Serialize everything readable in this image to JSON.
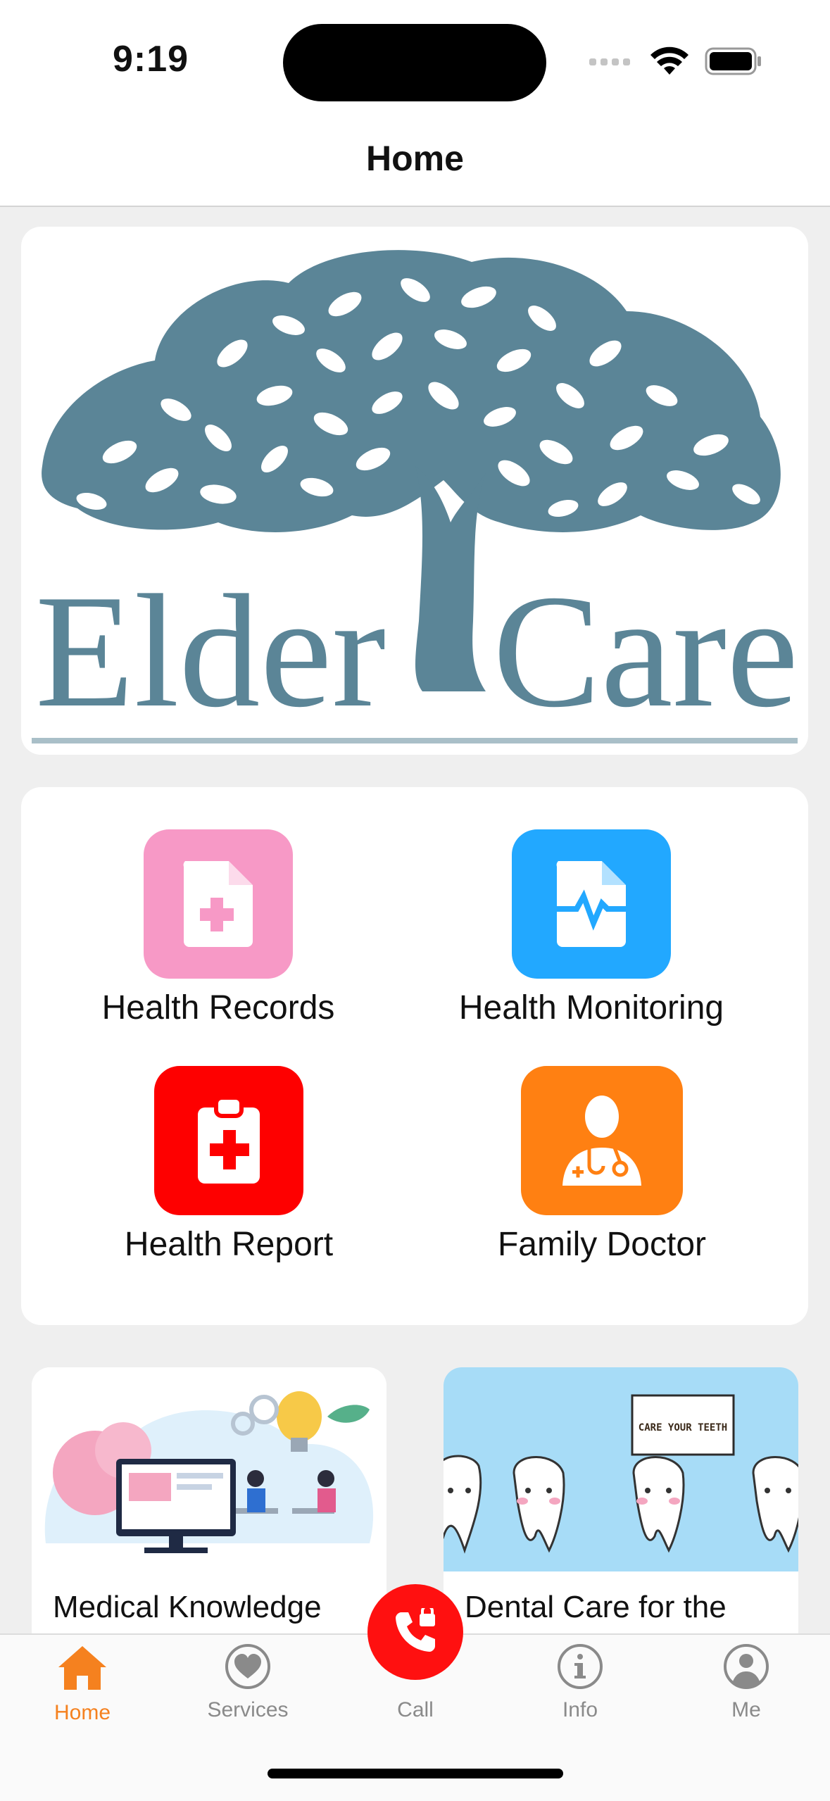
{
  "status_bar": {
    "time": "9:19"
  },
  "nav": {
    "title": "Home"
  },
  "logo": {
    "text_left": "Elder",
    "text_right": "Care",
    "color": "#5b8597"
  },
  "services": [
    {
      "label": "Health Records",
      "icon": "document-plus-icon",
      "color": "#f799c6"
    },
    {
      "label": "Health Monitoring",
      "icon": "document-pulse-icon",
      "color": "#22a8ff"
    },
    {
      "label": "Health Report",
      "icon": "clipboard-cross-icon",
      "color": "#fe0000"
    },
    {
      "label": "Family Doctor",
      "icon": "doctor-icon",
      "color": "#ff8012"
    }
  ],
  "articles": [
    {
      "title": "Medical Knowledge"
    },
    {
      "title": "Dental Care for the",
      "sign_text": "CARE YOUR TEETH"
    }
  ],
  "tabbar": {
    "items": [
      {
        "label": "Home",
        "icon": "home-icon",
        "active": true
      },
      {
        "label": "Services",
        "icon": "heart-icon"
      },
      {
        "label": "Call",
        "icon": "phone-icon"
      },
      {
        "label": "Info",
        "icon": "info-icon"
      },
      {
        "label": "Me",
        "icon": "person-icon"
      }
    ],
    "active_color": "#f5811f",
    "call_color": "#ff1010"
  }
}
